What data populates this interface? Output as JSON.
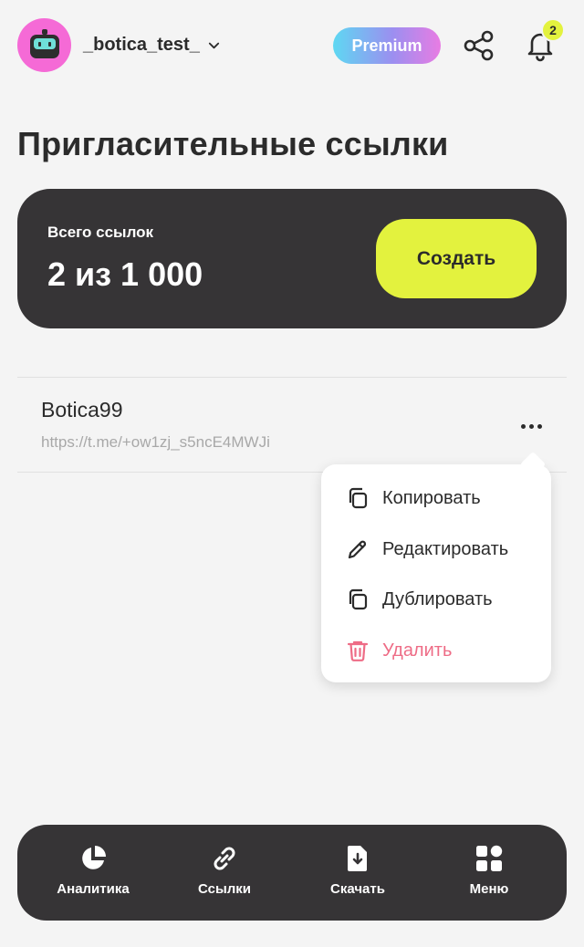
{
  "header": {
    "username": "_botica_test_",
    "premium_label": "Premium",
    "notification_count": "2",
    "icons": {
      "avatar": "robot-avatar",
      "share": "share-icon",
      "bell": "bell-icon",
      "chevron": "chevron-down-icon"
    }
  },
  "page": {
    "title": "Пригласительные ссылки"
  },
  "stats": {
    "label": "Всего ссылок",
    "value": "2 из 1 000",
    "create_label": "Создать"
  },
  "links": [
    {
      "name": "Botica99",
      "url": "https://t.me/+ow1zj_s5ncE4MWJi"
    }
  ],
  "context_menu": {
    "items": [
      {
        "label": "Копировать",
        "icon": "copy-icon"
      },
      {
        "label": "Редактировать",
        "icon": "pencil-icon"
      },
      {
        "label": "Дублировать",
        "icon": "duplicate-icon"
      },
      {
        "label": "Удалить",
        "icon": "trash-icon"
      }
    ]
  },
  "tabbar": {
    "items": [
      {
        "label": "Аналитика",
        "icon": "pie-chart-icon"
      },
      {
        "label": "Ссылки",
        "icon": "link-icon"
      },
      {
        "label": "Скачать",
        "icon": "download-file-icon"
      },
      {
        "label": "Меню",
        "icon": "grid-menu-icon"
      }
    ]
  },
  "colors": {
    "accent": "#e3f23e",
    "dark": "#363436",
    "danger": "#ee6c86",
    "avatar_bg": "#f56ad6",
    "background": "#f4f4f4"
  }
}
